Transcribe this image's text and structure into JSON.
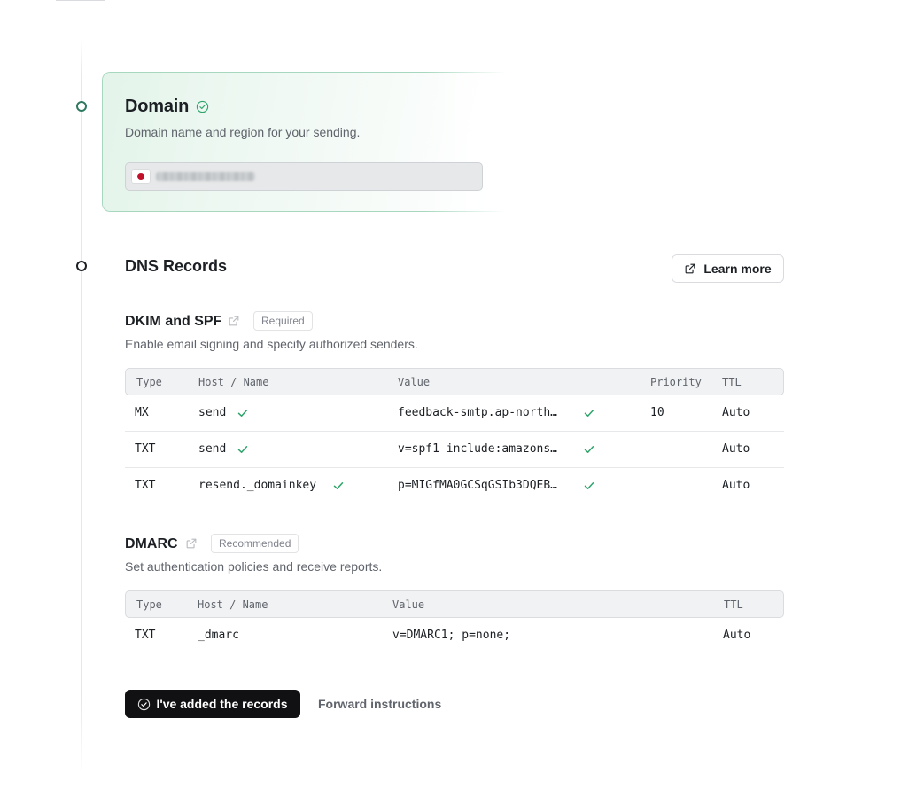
{
  "colors": {
    "accent_green": "#2f7a5f",
    "check_green": "#30a46c",
    "primary_button_bg": "#111113",
    "flag_red": "#c0102a"
  },
  "domain": {
    "title": "Domain",
    "status_icon": "check-circle-icon",
    "subtitle": "Domain name and region for your sending.",
    "region_flag": "japan-flag-icon"
  },
  "dns": {
    "title": "DNS Records",
    "learn_more_label": "Learn more",
    "learn_more_icon": "external-link-icon"
  },
  "dkim_spf": {
    "heading": "DKIM and SPF",
    "tag": "Required",
    "description": "Enable email signing and specify authorized senders.",
    "columns": [
      "Type",
      "Host / Name",
      "Value",
      "Priority",
      "TTL"
    ],
    "rows": [
      {
        "type": "MX",
        "host": "send",
        "value": "feedback-smtp.ap-north…",
        "priority": "10",
        "ttl": "Auto"
      },
      {
        "type": "TXT",
        "host": "send",
        "value": "v=spf1 include:amazons…",
        "priority": "",
        "ttl": "Auto"
      },
      {
        "type": "TXT",
        "host": "resend._domainkey",
        "value": "p=MIGfMA0GCSqGSIb3DQEB…",
        "priority": "",
        "ttl": "Auto"
      }
    ]
  },
  "dmarc": {
    "heading": "DMARC",
    "tag": "Recommended",
    "description": "Set authentication policies and receive reports.",
    "columns": [
      "Type",
      "Host / Name",
      "Value",
      "TTL"
    ],
    "rows": [
      {
        "type": "TXT",
        "host": "_dmarc",
        "value": "v=DMARC1; p=none;",
        "ttl": "Auto"
      }
    ]
  },
  "actions": {
    "primary_label": "I've added the records",
    "primary_icon": "check-circle-icon",
    "secondary_label": "Forward instructions"
  }
}
